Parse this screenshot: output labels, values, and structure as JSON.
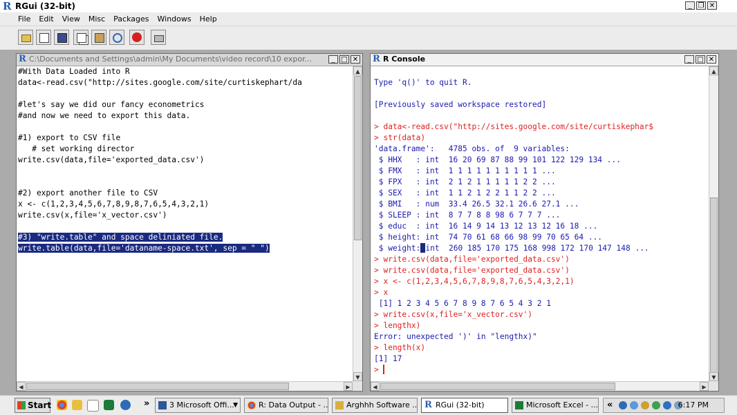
{
  "app": {
    "title": "RGui (32-bit)"
  },
  "menu": [
    "File",
    "Edit",
    "View",
    "Misc",
    "Packages",
    "Windows",
    "Help"
  ],
  "toolbar": [
    "open-script",
    "load-workspace",
    "save-workspace",
    "copy",
    "paste",
    "copy-paste",
    "stop",
    "print"
  ],
  "script_window": {
    "title": "C:\\Documents and Settings\\admin\\My Documents\\video record\\10 expor...",
    "lines": [
      {
        "text": "#With Data Loaded into R",
        "sel": false
      },
      {
        "text": "data<-read.csv(\"http://sites.google.com/site/curtiskephart/da",
        "sel": false
      },
      {
        "text": "",
        "sel": false
      },
      {
        "text": "#let's say we did our fancy econometrics",
        "sel": false
      },
      {
        "text": "#and now we need to export this data.",
        "sel": false
      },
      {
        "text": "",
        "sel": false
      },
      {
        "text": "#1) export to CSV file",
        "sel": false
      },
      {
        "text": "   # set working director",
        "sel": false
      },
      {
        "text": "write.csv(data,file='exported_data.csv')",
        "sel": false
      },
      {
        "text": "",
        "sel": false
      },
      {
        "text": "",
        "sel": false
      },
      {
        "text": "#2) export another file to CSV",
        "sel": false
      },
      {
        "text": "x <- c(1,2,3,4,5,6,7,8,9,8,7,6,5,4,3,2,1)",
        "sel": false
      },
      {
        "text": "write.csv(x,file='x_vector.csv')",
        "sel": false
      },
      {
        "text": "",
        "sel": false
      },
      {
        "text": "#3) \"write.table\" and space deliniated file.",
        "sel": true
      },
      {
        "text": "write.table(data,file='dataname-space.txt', sep = \" \")",
        "sel": true
      }
    ]
  },
  "console_window": {
    "title": "R Console",
    "lines": [
      {
        "text": "",
        "cls": ""
      },
      {
        "text": "Type 'q()' to quit R.",
        "cls": "out"
      },
      {
        "text": "",
        "cls": ""
      },
      {
        "text": "[Previously saved workspace restored]",
        "cls": "out"
      },
      {
        "text": "",
        "cls": ""
      },
      {
        "text": "> data<-read.csv(\"http://sites.google.com/site/curtiskephar$",
        "cls": "cmd"
      },
      {
        "text": "> str(data)",
        "cls": "cmd"
      },
      {
        "text": "'data.frame':   4785 obs. of  9 variables:",
        "cls": "out"
      },
      {
        "text": " $ HHX   : int  16 20 69 87 88 99 101 122 129 134 ...",
        "cls": "out"
      },
      {
        "text": " $ FMX   : int  1 1 1 1 1 1 1 1 1 1 ...",
        "cls": "out"
      },
      {
        "text": " $ FPX   : int  2 1 2 1 1 1 1 1 2 2 ...",
        "cls": "out"
      },
      {
        "text": " $ SEX   : int  1 1 2 1 2 2 1 1 2 2 ...",
        "cls": "out"
      },
      {
        "text": " $ BMI   : num  33.4 26.5 32.1 26.6 27.1 ...",
        "cls": "out"
      },
      {
        "text": " $ SLEEP : int  8 7 7 8 8 98 6 7 7 7 ...",
        "cls": "out"
      },
      {
        "text": " $ educ  : int  16 14 9 14 13 12 13 12 16 18 ...",
        "cls": "out"
      },
      {
        "text": " $ height: int  74 70 61 68 66 98 99 70 65 64 ...",
        "cls": "out"
      },
      {
        "text": " $ weight:",
        "cls": "out",
        "cursor": true,
        "rest": "int  260 185 170 175 168 998 172 170 147 148 ..."
      },
      {
        "text": "> write.csv(data,file='exported_data.csv')",
        "cls": "cmd"
      },
      {
        "text": "> write.csv(data,file='exported_data.csv')",
        "cls": "cmd"
      },
      {
        "text": "> x <- c(1,2,3,4,5,6,7,8,9,8,7,6,5,4,3,2,1)",
        "cls": "cmd"
      },
      {
        "text": "> x",
        "cls": "cmd"
      },
      {
        "text": " [1] 1 2 3 4 5 6 7 8 9 8 7 6 5 4 3 2 1",
        "cls": "out"
      },
      {
        "text": "> write.csv(x,file='x_vector.csv')",
        "cls": "cmd"
      },
      {
        "text": "> lengthx)",
        "cls": "cmd"
      },
      {
        "text": "Error: unexpected ')' in \"lengthx)\"",
        "cls": "out"
      },
      {
        "text": "> length(x)",
        "cls": "cmd"
      },
      {
        "text": "[1] 17",
        "cls": "out"
      },
      {
        "text": "> ",
        "cls": "cmd",
        "prompt": true
      }
    ]
  },
  "taskbar": {
    "start": "Start",
    "chevron": "»",
    "tasks": [
      {
        "label": "3 Microsoft Offi...",
        "color": "#2b579a",
        "active": false
      },
      {
        "label": "R: Data Output - ...",
        "color": "#e8a020",
        "active": false
      },
      {
        "label": "Arghhh Software ...",
        "color": "#d8b040",
        "active": false
      },
      {
        "label": "RGui (32-bit)",
        "color": "#2a5fb0",
        "active": true
      },
      {
        "label": "Microsoft Excel - ...",
        "color": "#1d7a3a",
        "active": false
      }
    ],
    "tray_chevron": "«",
    "clock": "6:17 PM"
  }
}
